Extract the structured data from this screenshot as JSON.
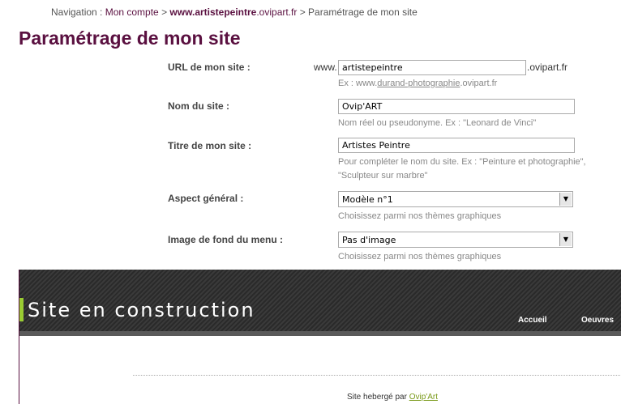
{
  "breadcrumb": {
    "prefix": "Navigation : ",
    "account": "Mon compte",
    "separator": " > ",
    "site_bold": "www.artistepeintre",
    "site_rest": ".ovipart.fr",
    "separator2": " > ",
    "current": "Paramétrage de mon site"
  },
  "page_title": "Paramétrage de mon site",
  "form": {
    "url": {
      "label": "URL de mon site :",
      "prefix": "www.",
      "value": "artistepeintre",
      "suffix": ".ovipart.fr",
      "help_prefix": "Ex : www.",
      "help_link": "durand-photographie",
      "help_suffix": ".ovipart.fr"
    },
    "site_name": {
      "label": "Nom du site :",
      "value": "Ovip'ART",
      "help": "Nom réel ou pseudonyme. Ex : \"Leonard de Vinci\""
    },
    "site_title": {
      "label": "Titre de mon site :",
      "value": "Artistes Peintre",
      "help_line1": "Pour compléter le nom du site. Ex : \"Peinture et photographie\",",
      "help_line2": "\"Sculpteur sur marbre\""
    },
    "aspect": {
      "label": "Aspect général :",
      "selected": "Modèle n°1",
      "help": "Choisissez parmi nos thèmes graphiques"
    },
    "menu_bg": {
      "label": "Image de fond du menu :",
      "selected": "Pas d'image",
      "help": "Choisissez parmi nos thèmes graphiques"
    }
  },
  "preview": {
    "site_title": "Site en construction",
    "nav": [
      "Accueil",
      "Oeuvres"
    ],
    "footer_prefix": "Site hebergé par ",
    "footer_link": "Ovip'Art",
    "accent_color": "#9acd32"
  },
  "colors": {
    "brand": "#5a1040",
    "help_text": "#888888"
  },
  "icons": {
    "select_arrow": "chevron-down-icon"
  }
}
